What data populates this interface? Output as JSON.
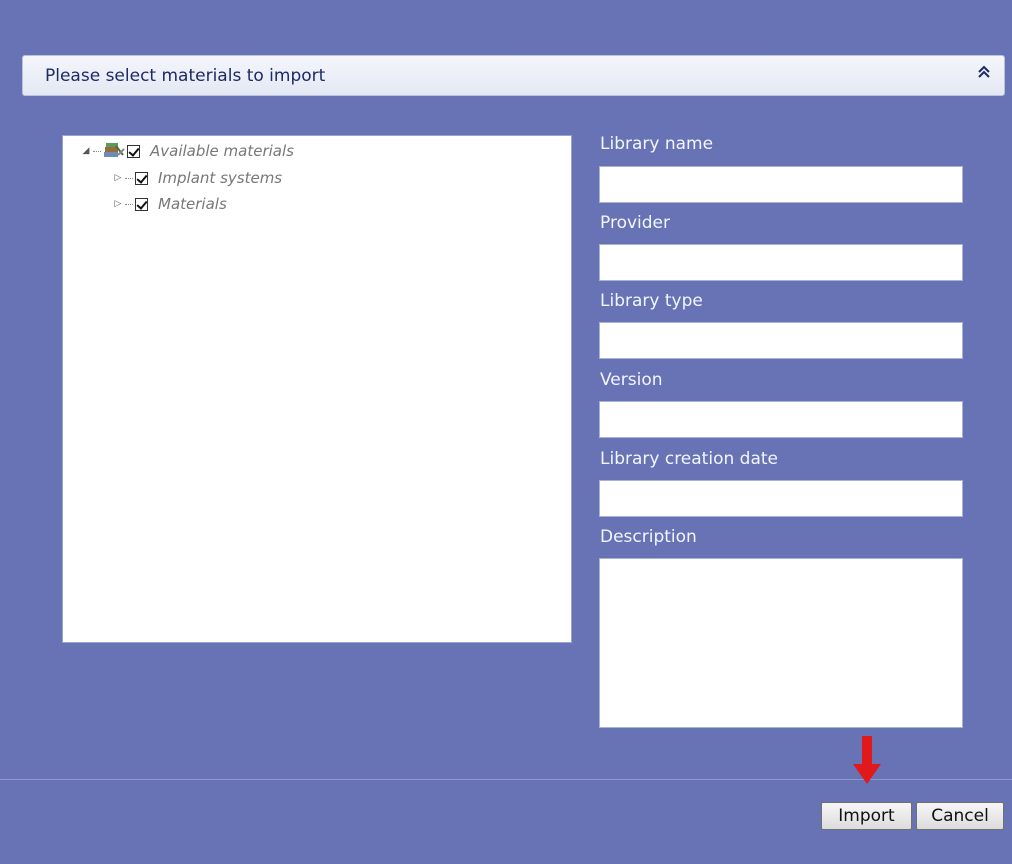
{
  "dialog": {
    "title": "Please select materials to import",
    "collapse_glyph": "»"
  },
  "tree": {
    "root": {
      "label": "Available materials",
      "icon": "library-icon",
      "checked": true,
      "expanded": true
    },
    "children": [
      {
        "label": "Implant systems",
        "checked": true,
        "expanded": false
      },
      {
        "label": "Materials",
        "checked": true,
        "expanded": false
      }
    ]
  },
  "fields": {
    "library_name": {
      "label": "Library name",
      "value": ""
    },
    "provider": {
      "label": "Provider",
      "value": ""
    },
    "library_type": {
      "label": "Library type",
      "value": ""
    },
    "version": {
      "label": "Version",
      "value": ""
    },
    "creation_date": {
      "label": "Library creation date",
      "value": ""
    },
    "description": {
      "label": "Description",
      "value": ""
    }
  },
  "buttons": {
    "import_label": "Import",
    "cancel_label": "Cancel"
  },
  "colors": {
    "background": "#6873b6",
    "highlight_arrow": "#e0191b"
  }
}
